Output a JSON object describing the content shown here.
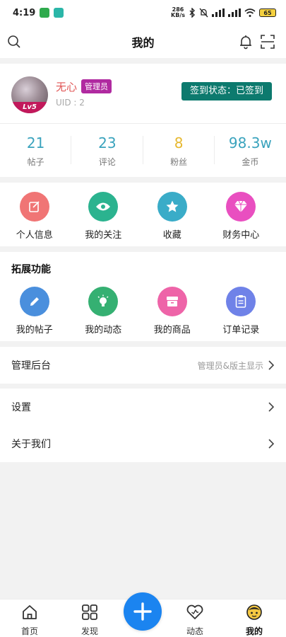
{
  "status_bar": {
    "time": "4:19",
    "speed_value": "286",
    "speed_unit": "KB/s",
    "battery": "65"
  },
  "header": {
    "title": "我的"
  },
  "profile": {
    "name": "无心",
    "role_badge": "管理员",
    "uid": "UID : 2",
    "level": "Lv5",
    "sign_in_status": "签到状态：已签到"
  },
  "stats": [
    {
      "value": "21",
      "label": "帖子",
      "color": "#3aa3bd"
    },
    {
      "value": "23",
      "label": "评论",
      "color": "#3aa3bd"
    },
    {
      "value": "8",
      "label": "粉丝",
      "color": "#e6b830"
    },
    {
      "value": "98.3w",
      "label": "金币",
      "color": "#3aa3bd"
    }
  ],
  "quick_menu": [
    {
      "label": "个人信息",
      "icon": "edit-icon",
      "color": "#f07575"
    },
    {
      "label": "我的关注",
      "icon": "eye-icon",
      "color": "#2bb38f"
    },
    {
      "label": "收藏",
      "icon": "star-icon",
      "color": "#3aacc8"
    },
    {
      "label": "财务中心",
      "icon": "diamond-icon",
      "color": "#e94fc0"
    }
  ],
  "extended": {
    "title": "拓展功能",
    "items": [
      {
        "label": "我的帖子",
        "icon": "pencil-icon",
        "color": "#4a8fdd"
      },
      {
        "label": "我的动态",
        "icon": "lightbulb-icon",
        "color": "#35b072"
      },
      {
        "label": "我的商品",
        "icon": "box-icon",
        "color": "#ee64a8"
      },
      {
        "label": "订单记录",
        "icon": "clipboard-icon",
        "color": "#6f82e8"
      }
    ]
  },
  "admin_row": {
    "label": "管理后台",
    "hint": "管理员&版主显示"
  },
  "settings_row": {
    "label": "设置"
  },
  "about_row": {
    "label": "关于我们"
  },
  "tabbar": {
    "items": [
      {
        "label": "首页",
        "icon": "home-icon"
      },
      {
        "label": "发现",
        "icon": "grid-icon"
      },
      {
        "label": "动态",
        "icon": "heart-icon"
      },
      {
        "label": "我的",
        "icon": "face-icon"
      }
    ],
    "active": "我的"
  }
}
